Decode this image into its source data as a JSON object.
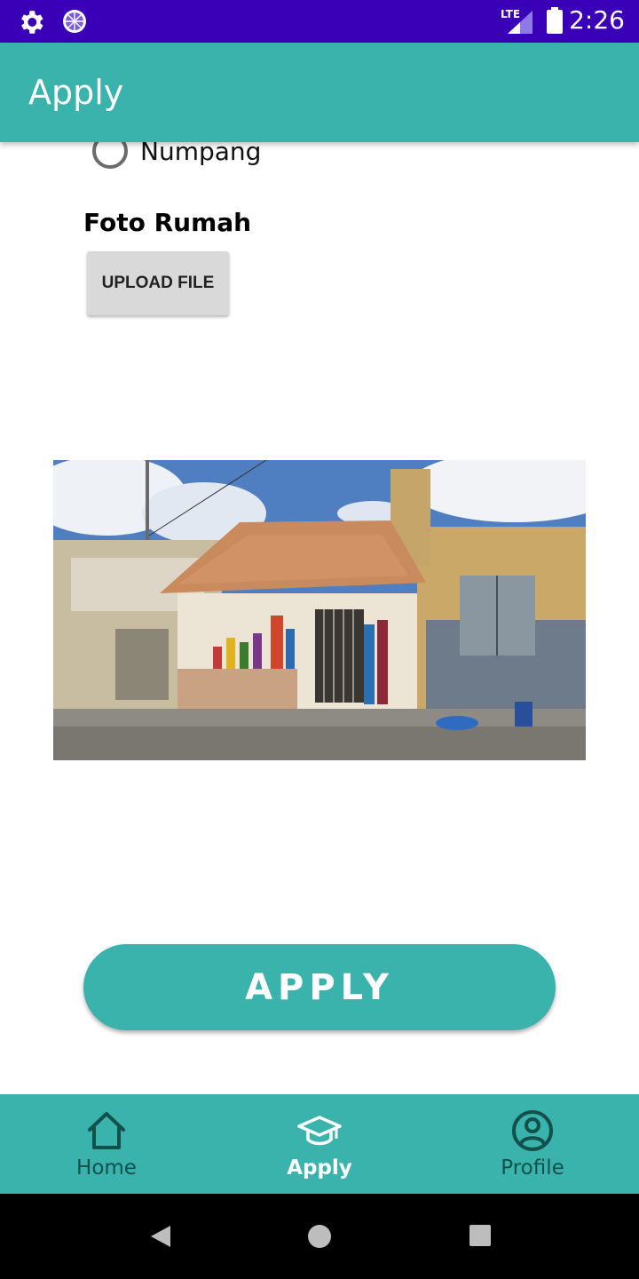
{
  "status_bar": {
    "time": "2:26",
    "network": "LTE",
    "icons": [
      "settings-icon",
      "sync-icon",
      "lte-signal-icon",
      "battery-icon"
    ]
  },
  "app_bar": {
    "title": "Apply"
  },
  "form": {
    "radio_option": {
      "label": "Numpang",
      "selected": false
    },
    "photo_section": {
      "label": "Foto Rumah",
      "upload_button": "UPLOAD FILE"
    },
    "submit_button": "APPLY"
  },
  "bottom_nav": {
    "items": [
      {
        "label": "Home",
        "icon": "home-icon",
        "active": false
      },
      {
        "label": "Apply",
        "icon": "graduation-cap-icon",
        "active": true
      },
      {
        "label": "Profile",
        "icon": "profile-icon",
        "active": false
      }
    ]
  },
  "colors": {
    "status_bar": "#3a00b8",
    "accent": "#3ab3ad",
    "nav_inactive": "#12504c",
    "nav_active": "#ffffff"
  },
  "system_nav": {
    "icons": [
      "back-icon",
      "home-circle-icon",
      "recents-icon"
    ]
  }
}
